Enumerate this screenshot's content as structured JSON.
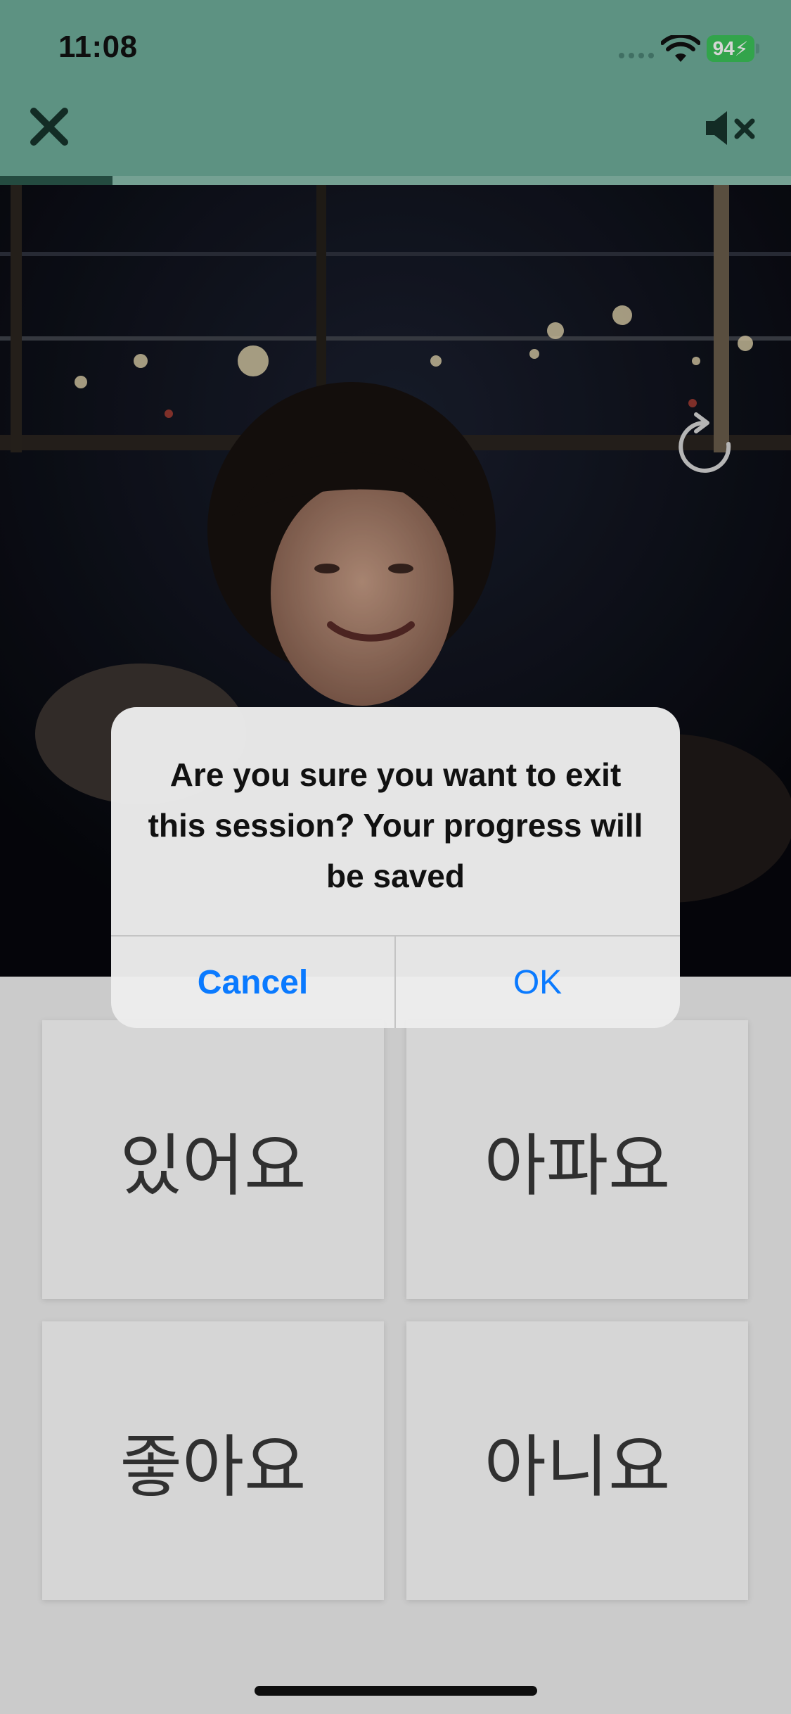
{
  "status_bar": {
    "time": "11:08",
    "battery": "94"
  },
  "header": {
    "close_icon": "close-icon",
    "mute_icon": "speaker-muted-icon",
    "progress": 0.142
  },
  "video": {
    "replay_icon": "replay-icon"
  },
  "answers": [
    "있어요",
    "아파요",
    "좋아요",
    "아니요"
  ],
  "alert": {
    "message": "Are you sure you want to exit this session? Your progress will be saved",
    "cancel_label": "Cancel",
    "ok_label": "OK"
  },
  "colors": {
    "header_bg": "#6fae9b",
    "progress": "#2c5a4d",
    "accent": "#0a7aff",
    "battery": "#3cc45a"
  }
}
